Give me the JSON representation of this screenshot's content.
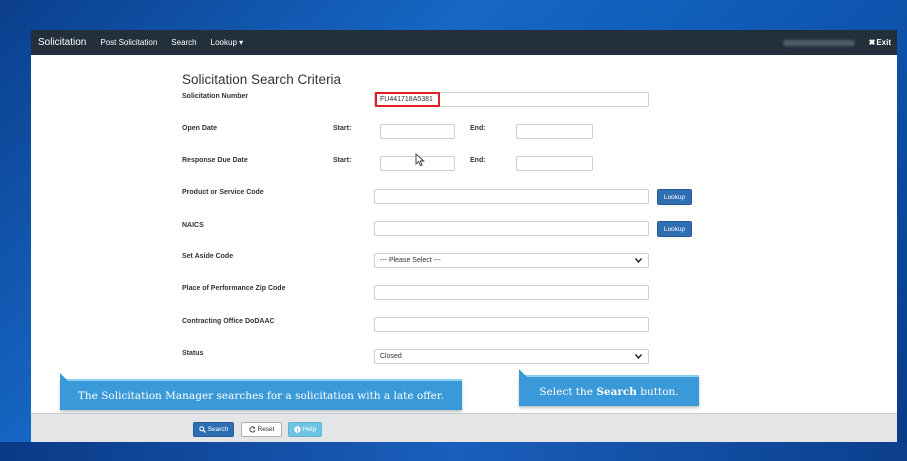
{
  "nav": {
    "brand": "Solicitation",
    "links": [
      "Post Solicitation",
      "Search",
      "Lookup ▾"
    ],
    "exit_icon": "✖",
    "exit_label": "Exit"
  },
  "form": {
    "title": "Solicitation Search Criteria",
    "solicitation_number_label": "Solicitation Number",
    "solicitation_number_value": "FU441718A5381",
    "open_date_label": "Open Date",
    "response_due_label": "Response Due Date",
    "start_label": "Start:",
    "end_label": "End:",
    "psc_label": "Product or Service Code",
    "naics_label": "NAICS",
    "lookup_label": "Lookup",
    "set_aside_label": "Set Aside Code",
    "set_aside_value": "--- Please Select ---",
    "zip_label": "Place of Performance Zip Code",
    "dodaac_label": "Contracting Office DoDAAC",
    "status_label": "Status",
    "status_value": "Closed"
  },
  "callouts": {
    "left": "The Solicitation Manager searches for a solicitation with a late offer.",
    "right_prefix": "Select the ",
    "right_bold": "Search",
    "right_suffix": " button."
  },
  "footer": {
    "search_label": "Search",
    "reset_label": "Reset",
    "help_label": "Help"
  },
  "colors": {
    "navbar": "#242f3c",
    "primary": "#2e6fb4",
    "callout": "#3a99d8",
    "highlight": "#e02020"
  }
}
